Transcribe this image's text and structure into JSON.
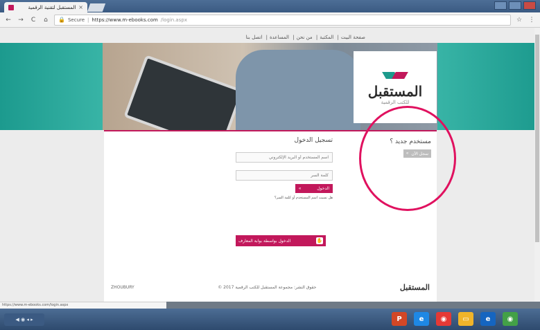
{
  "browser": {
    "tab_title": "المستقبل لتقنية الرقمية",
    "tab_close": "×",
    "nav_back": "←",
    "nav_forward": "→",
    "reload": "C",
    "home": "⌂",
    "secure_label": "Secure",
    "url_host": "https://www.m-ebooks.com",
    "url_path": "/login.aspx",
    "star": "☆",
    "menu": "⋮",
    "status_url": "https://www.m-ebooks.com/login.aspx"
  },
  "top_nav": [
    "صفحة البيت",
    "المكتبة",
    "من نحن",
    "المساعدة",
    "اتصل بنا"
  ],
  "brand": {
    "logo_text": "المستقبل",
    "logo_sub": "للكتب الرقمية"
  },
  "login": {
    "heading": "تسجيل الدخول",
    "username_placeholder": "اسم المستخدم أو البريد الإلكتروني",
    "password_placeholder": "كلمة السر",
    "button_label": "الدخول",
    "button_arrow": "»",
    "forgot": "هل نسيت اسم المستخدم أو كلمة السر؟"
  },
  "new_user": {
    "heading": "مستخدم جديد ؟",
    "button_label": "سجل الآن",
    "button_arrow": "»"
  },
  "sso": {
    "label": "الدخول بواسطة بوابة المعارف",
    "icon": "✋"
  },
  "footer": {
    "copyright": "حقوق النشر: مجموعة المستقبل للكتب الرقمية 2017 ©",
    "logo_text": "المستقبل",
    "partner": "ZHOUBURY"
  },
  "taskbar": {
    "start": "◀ ◉ ◂ ▸",
    "icons": [
      {
        "name": "office-icon",
        "glyph": "P",
        "color": "#d24726"
      },
      {
        "name": "ie-icon",
        "glyph": "e",
        "color": "#1e88e5"
      },
      {
        "name": "chrome-icon",
        "glyph": "◉",
        "color": "#e53935"
      },
      {
        "name": "folder-icon",
        "glyph": "▭",
        "color": "#f0b429"
      },
      {
        "name": "edge-icon",
        "glyph": "e",
        "color": "#1565c0"
      },
      {
        "name": "chrome-alt-icon",
        "glyph": "◉",
        "color": "#43a047"
      }
    ]
  },
  "colors": {
    "brand_pink": "#c2185b",
    "brand_teal": "#1d9a8c",
    "annotation_circle": "#e0115f"
  }
}
